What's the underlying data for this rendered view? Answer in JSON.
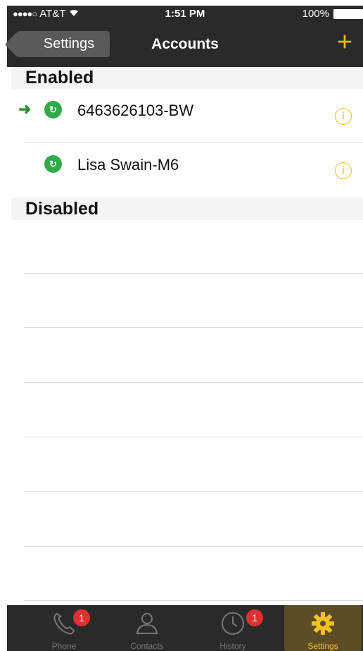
{
  "status": {
    "signal": "●●●●○",
    "carrier": "AT&T",
    "wifi_icon": "wifi-icon",
    "time": "1:51 PM",
    "battery": "100%"
  },
  "nav": {
    "back_label": "Settings",
    "title": "Accounts",
    "add_label": "+"
  },
  "sections": {
    "enabled_title": "Enabled",
    "disabled_title": "Disabled"
  },
  "accounts": [
    {
      "name": "6463626103-BW",
      "active": true
    },
    {
      "name": "Lisa Swain-M6",
      "active": false
    }
  ],
  "tabs": [
    {
      "label": "Phone",
      "badge": "1"
    },
    {
      "label": "Contacts"
    },
    {
      "label": "History",
      "badge": "1"
    },
    {
      "label": "Settings"
    }
  ],
  "colors": {
    "accent": "#f5b81c",
    "bar": "#2a2a2a",
    "account_icon": "#32a94a",
    "badge": "#e23030"
  }
}
